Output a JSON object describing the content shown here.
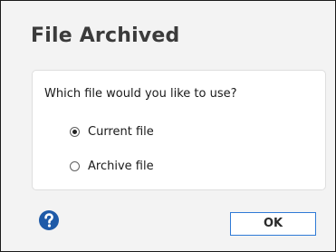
{
  "dialog": {
    "title": "File Archived",
    "question": "Which file would you like to use?",
    "options": [
      {
        "label": "Current file",
        "selected": true
      },
      {
        "label": "Archive file",
        "selected": false
      }
    ],
    "help_icon": "question-circle-icon",
    "ok_label": "OK"
  },
  "colors": {
    "accent": "#2f7ad6",
    "help_icon": "#1e5aa8",
    "background": "#f3f3f3"
  }
}
